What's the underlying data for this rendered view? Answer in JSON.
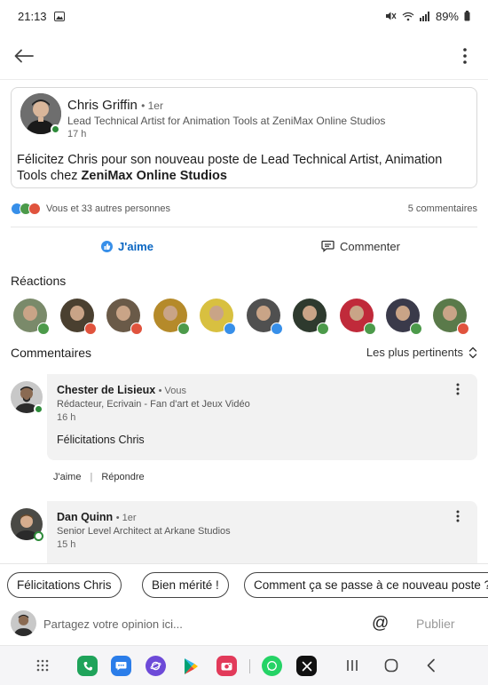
{
  "status_bar": {
    "time": "21:13",
    "battery": "89%"
  },
  "post": {
    "author_name": "Chris Griffin",
    "author_degree": "• 1er",
    "author_headline": "Lead Technical Artist for Animation Tools at ZeniMax Online Studios",
    "time": "17 h",
    "text_prefix": "Félicitez Chris pour son nouveau poste de Lead Technical Artist, Animation Tools chez ",
    "text_company": "ZeniMax Online Studios"
  },
  "social": {
    "reactions_summary": "Vous et 33 autres personnes",
    "comments_count": "5 commentaires"
  },
  "actions": {
    "like_label": "J'aime",
    "comment_label": "Commenter"
  },
  "reactions_section": {
    "title": "Réactions",
    "reactors": [
      {
        "badge": "support",
        "avatar_color": "#7a8a6a"
      },
      {
        "badge": "love",
        "avatar_color": "#4a4030"
      },
      {
        "badge": "love",
        "avatar_color": "#6a5a48"
      },
      {
        "badge": "support",
        "avatar_color": "#b58a2a"
      },
      {
        "badge": "like",
        "avatar_color": "#d8c040"
      },
      {
        "badge": "like",
        "avatar_color": "#505050"
      },
      {
        "badge": "support",
        "avatar_color": "#2e3a2e"
      },
      {
        "badge": "support",
        "avatar_color": "#c02a3a"
      },
      {
        "badge": "support",
        "avatar_color": "#3a3a4a"
      },
      {
        "badge": "love",
        "avatar_color": "#5a7a4a"
      }
    ]
  },
  "comments_section": {
    "title": "Commentaires",
    "sort_label": "Les plus pertinents",
    "comments": [
      {
        "name": "Chester de Lisieux",
        "degree": "• Vous",
        "headline": "Rédacteur, Ecrivain - Fan d'art et Jeux Vidéo",
        "time": "16 h",
        "body": "Félicitations Chris",
        "like_label": "J'aime",
        "separator": "|",
        "reply_label": "Répondre"
      },
      {
        "name": "Dan Quinn",
        "degree": "• 1er",
        "headline": "Senior Level Architect at Arkane Studios",
        "time": "15 h"
      }
    ]
  },
  "suggestions": [
    "Félicitations Chris",
    "Bien mérité !",
    "Comment ça se passe à ce nouveau poste ?"
  ],
  "comment_input": {
    "placeholder": "Partagez votre opinion ici...",
    "mention_symbol": "@",
    "publish_label": "Publier"
  },
  "colors": {
    "linkedin_blue": "#0a66c2",
    "online_green": "#2e8b3a",
    "love_red": "#e0533d",
    "support_green": "#4c9a4a"
  }
}
